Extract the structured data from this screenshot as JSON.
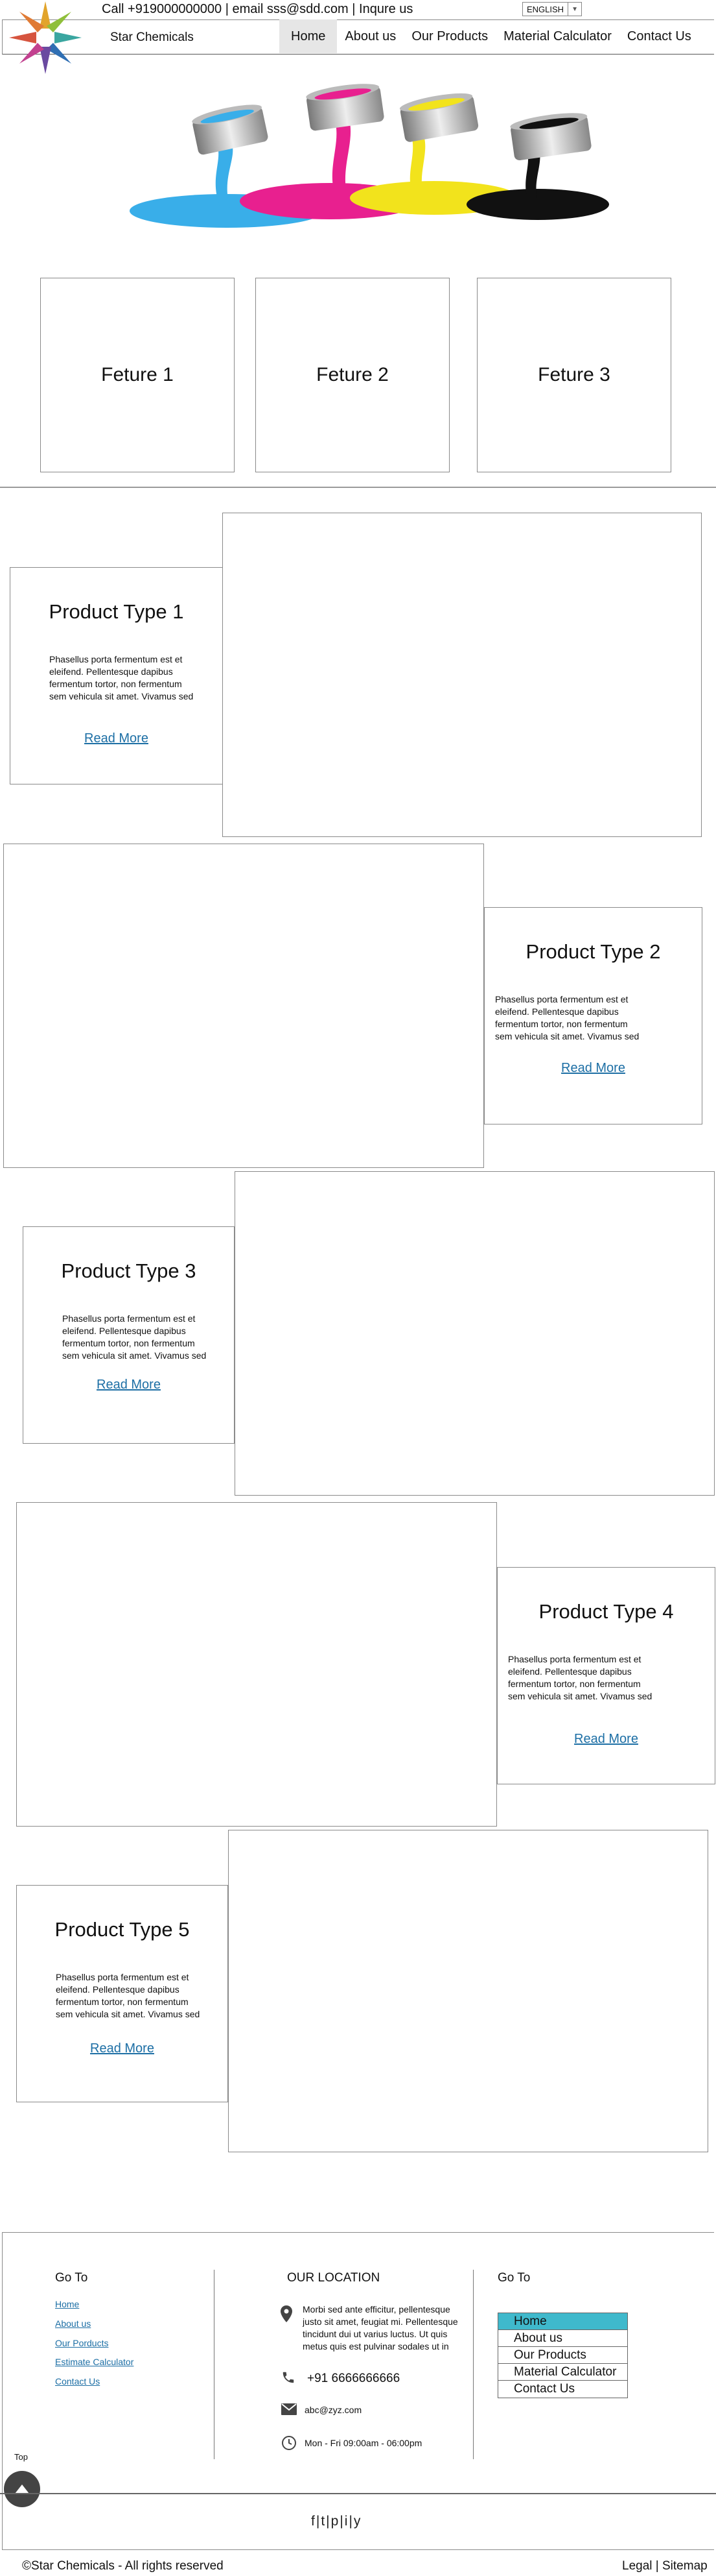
{
  "topbar": {
    "call": "Call +919000000000 | email sss@sdd.com | Inqure us",
    "language": "ENGLISH"
  },
  "brand": {
    "name": "Star Chemicals"
  },
  "nav": {
    "items": [
      {
        "label": "Home",
        "active": true
      },
      {
        "label": "About us"
      },
      {
        "label": "Our Products"
      },
      {
        "label": "Material Calculator"
      },
      {
        "label": "Contact Us"
      }
    ]
  },
  "features": [
    {
      "label": "Feture 1"
    },
    {
      "label": "Feture 2"
    },
    {
      "label": "Feture 3"
    }
  ],
  "products": [
    {
      "title": "Product Type 1",
      "desc": "Phasellus porta fermentum est et eleifend. Pellentesque dapibus fermentum tortor, non fermentum sem vehicula sit amet. Vivamus sed",
      "more": "Read More"
    },
    {
      "title": "Product Type 2",
      "desc": "Phasellus porta fermentum est et eleifend. Pellentesque dapibus fermentum tortor, non fermentum sem vehicula sit amet. Vivamus sed",
      "more": "Read More"
    },
    {
      "title": "Product Type 3",
      "desc": "Phasellus porta fermentum est et eleifend. Pellentesque dapibus fermentum tortor, non fermentum sem vehicula sit amet. Vivamus sed",
      "more": "Read More"
    },
    {
      "title": "Product Type 4",
      "desc": "Phasellus porta fermentum est et eleifend. Pellentesque dapibus fermentum tortor, non fermentum sem vehicula sit amet. Vivamus sed",
      "more": "Read More"
    },
    {
      "title": "Product Type 5",
      "desc": "Phasellus porta fermentum est et eleifend. Pellentesque dapibus fermentum tortor, non fermentum sem vehicula sit amet. Vivamus sed",
      "more": "Read More"
    }
  ],
  "footer": {
    "goto_title": "Go To",
    "goto_links": [
      "Home",
      "About us",
      "Our Porducts",
      "Estimate Calculator",
      "Contact Us"
    ],
    "location_title": "OUR LOCATION",
    "address": "Morbi sed ante efficitur, pellentesque justo sit amet, feugiat mi. Pellentesque tincidunt dui ut varius luctus. Ut quis metus quis est pulvinar sodales ut in",
    "phone": "+91 6666666666",
    "email": "abc@zyz.com",
    "hours": "Mon - Fri 09:00am - 06:00pm",
    "goto2_title": "Go To",
    "menu": [
      {
        "label": "Home",
        "active": true
      },
      {
        "label": "About us"
      },
      {
        "label": "Our Products"
      },
      {
        "label": "Material Calculator"
      },
      {
        "label": "Contact Us"
      }
    ],
    "social": {
      "f": "f",
      "sep": "|",
      "t": "t",
      "p": "p",
      "i": "i",
      "y": "y"
    },
    "top_label": "Top",
    "copyright": "©Star Chemicals - All rights reserved",
    "legal": "Legal",
    "legal_sep": "|",
    "sitemap": "Sitemap"
  },
  "colors": {
    "menu_active": "#3fb9cc",
    "link": "#1d6fa5"
  }
}
